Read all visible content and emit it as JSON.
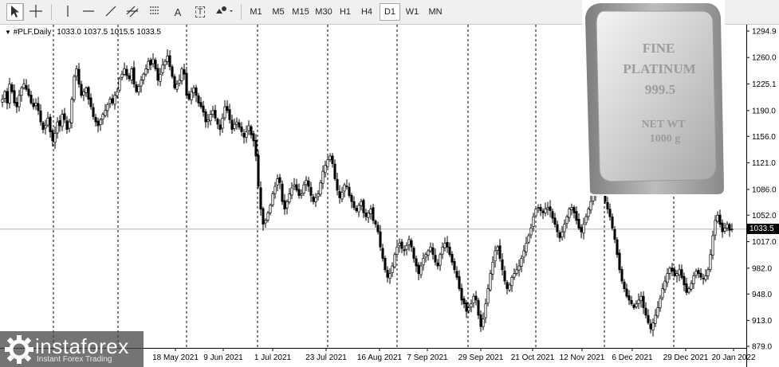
{
  "toolbar": {
    "timeframes": [
      "M1",
      "M5",
      "M15",
      "M30",
      "H1",
      "H4",
      "D1",
      "W1",
      "MN"
    ],
    "active_timeframe": "D1",
    "tools": [
      {
        "icon": "cursor-icon"
      },
      {
        "icon": "crosshair-icon"
      },
      {
        "icon": "vertical-line-icon"
      },
      {
        "icon": "horizontal-line-icon"
      },
      {
        "icon": "trendline-icon"
      },
      {
        "icon": "channel-icon"
      },
      {
        "icon": "fibonacci-icon"
      },
      {
        "icon": "text-icon",
        "glyph": "A"
      },
      {
        "icon": "text-label-icon",
        "glyph": "T"
      },
      {
        "icon": "shapes-icon"
      }
    ]
  },
  "chart_header": {
    "symbol_line": "#PLF,Daily",
    "ohlc": "1033.0 1037.5 1015.5 1033.5"
  },
  "current_price": "1033.5",
  "colors": {
    "background": "#ffffff",
    "candle": "#000000",
    "grid": "#000000",
    "price_tag": "#000000"
  },
  "chart_data": {
    "type": "candlestick",
    "y_ticks": [
      1294.9,
      1260.0,
      1225.1,
      1190.0,
      1156.0,
      1121.0,
      1086.0,
      1052.0,
      1017.0,
      982.0,
      948.0,
      913.0,
      879.0
    ],
    "ylim": [
      879.0,
      1294.9
    ],
    "x_labels": [
      "18 May 2021",
      "9 Jun 2021",
      "1 Jul 2021",
      "23 Jul 2021",
      "16 Aug 2021",
      "7 Sep 2021",
      "29 Sep 2021",
      "21 Oct 2021",
      "12 Nov 2021",
      "6 Dec 2021",
      "29 Dec 2021",
      "20 Jan 2022"
    ],
    "current_price": 1033.5,
    "closes": [
      1205,
      1215,
      1200,
      1225,
      1215,
      1200,
      1195,
      1210,
      1220,
      1225,
      1218,
      1210,
      1200,
      1195,
      1200,
      1190,
      1175,
      1165,
      1170,
      1180,
      1162,
      1150,
      1160,
      1175,
      1170,
      1185,
      1178,
      1165,
      1175,
      1205,
      1235,
      1245,
      1225,
      1210,
      1215,
      1220,
      1205,
      1195,
      1182,
      1175,
      1170,
      1178,
      1185,
      1190,
      1198,
      1205,
      1200,
      1210,
      1215,
      1232,
      1238,
      1245,
      1236,
      1232,
      1245,
      1225,
      1215,
      1222,
      1230,
      1238,
      1245,
      1255,
      1250,
      1258,
      1245,
      1230,
      1238,
      1250,
      1255,
      1262,
      1248,
      1235,
      1220,
      1225,
      1230,
      1245,
      1238,
      1210,
      1205,
      1215,
      1220,
      1210,
      1200,
      1195,
      1188,
      1175,
      1178,
      1185,
      1190,
      1180,
      1172,
      1165,
      1180,
      1195,
      1190,
      1178,
      1165,
      1172,
      1175,
      1168,
      1162,
      1155,
      1162,
      1170,
      1158,
      1150,
      1130,
      1090,
      1060,
      1040,
      1045,
      1055,
      1065,
      1080,
      1090,
      1100,
      1095,
      1070,
      1060,
      1070,
      1080,
      1088,
      1092,
      1085,
      1078,
      1080,
      1092,
      1098,
      1090,
      1078,
      1070,
      1075,
      1080,
      1095,
      1110,
      1118,
      1125,
      1130,
      1120,
      1100,
      1085,
      1075,
      1082,
      1092,
      1090,
      1078,
      1070,
      1062,
      1058,
      1065,
      1070,
      1055,
      1050,
      1055,
      1060,
      1045,
      1040,
      1030,
      1010,
      995,
      980,
      970,
      975,
      985,
      1000,
      1010,
      1015,
      1008,
      1005,
      1012,
      1020,
      1010,
      995,
      985,
      975,
      985,
      995,
      1000,
      1005,
      1010,
      1000,
      990,
      985,
      1000,
      1010,
      1015,
      1010,
      1000,
      990,
      980,
      970,
      955,
      940,
      935,
      925,
      930,
      935,
      945,
      940,
      920,
      905,
      915,
      935,
      955,
      975,
      990,
      1005,
      1010,
      995,
      980,
      965,
      955,
      960,
      970,
      975,
      980,
      985,
      995,
      1005,
      1015,
      1025,
      1035,
      1050,
      1060,
      1062,
      1058,
      1055,
      1060,
      1062,
      1058,
      1048,
      1040,
      1030,
      1022,
      1030,
      1040,
      1050,
      1060,
      1062,
      1055,
      1045,
      1035,
      1030,
      1040,
      1050,
      1060,
      1070,
      1080,
      1090,
      1095,
      1092,
      1085,
      1070,
      1060,
      1050,
      1035,
      1020,
      1000,
      980,
      965,
      955,
      945,
      940,
      935,
      930,
      935,
      940,
      945,
      930,
      920,
      910,
      902,
      910,
      920,
      930,
      942,
      955,
      965,
      975,
      982,
      978,
      972,
      975,
      980,
      970,
      960,
      950,
      955,
      962,
      972,
      978,
      975,
      970,
      968,
      972,
      980,
      1000,
      1025,
      1045,
      1052,
      1040,
      1030,
      1035,
      1040,
      1032,
      1033.5
    ]
  }
}
